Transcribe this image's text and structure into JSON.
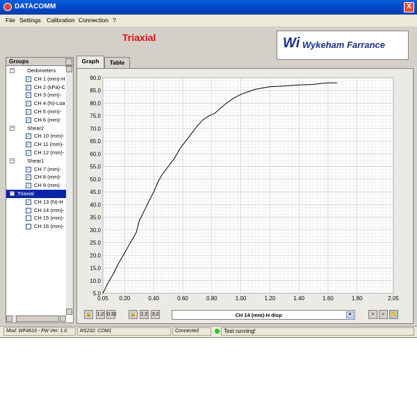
{
  "window": {
    "title": "DATACOMM",
    "close_label": "X"
  },
  "menu": [
    "File",
    "Settings",
    "Calibration",
    "Connection",
    "?"
  ],
  "app_title": "Triaxial",
  "logo": {
    "mark": "Wi",
    "text": "Wykeham Farrance"
  },
  "groups_panel": {
    "header": "Groups",
    "rows": [
      {
        "type": "group",
        "label": "Oedometers",
        "expander": "−",
        "selected": false
      },
      {
        "type": "channel",
        "label": "CH 1 (mm)-H",
        "checked": true
      },
      {
        "type": "channel",
        "label": "CH 2 (kPa)-C",
        "checked": true
      },
      {
        "type": "channel",
        "label": "CH 3 (mm)-",
        "checked": true
      },
      {
        "type": "channel",
        "label": "CH 4 (N)-Loa",
        "checked": true
      },
      {
        "type": "channel",
        "label": "CH 5 (mm)-",
        "checked": true
      },
      {
        "type": "channel",
        "label": "CH 6 (mm)-",
        "checked": true
      },
      {
        "type": "group",
        "label": "Shear2",
        "expander": "−",
        "selected": false
      },
      {
        "type": "channel",
        "label": "CH 10 (mm)-",
        "checked": true
      },
      {
        "type": "channel",
        "label": "CH 11 (mm)-",
        "checked": true
      },
      {
        "type": "channel",
        "label": "CH 12 (mm)-",
        "checked": true
      },
      {
        "type": "group",
        "label": "Shear1",
        "expander": "−",
        "selected": false
      },
      {
        "type": "channel",
        "label": "CH 7 (mm)-",
        "checked": true
      },
      {
        "type": "channel",
        "label": "CH 8 (mm)-",
        "checked": true
      },
      {
        "type": "channel",
        "label": "CH 9 (mm)-",
        "checked": true
      },
      {
        "type": "group",
        "label": "Triaxial",
        "expander": "−",
        "selected": true
      },
      {
        "type": "channel",
        "label": "CH 13 (N)-H",
        "checked": true
      },
      {
        "type": "channel",
        "label": "CH 14 (mm)-",
        "checked": false
      },
      {
        "type": "channel",
        "label": "CH 15 (mm)-",
        "checked": false
      },
      {
        "type": "channel",
        "label": "CH 16 (mm)-",
        "checked": false
      }
    ]
  },
  "tabs": [
    {
      "label": "Graph",
      "active": true
    },
    {
      "label": "Table",
      "active": false
    }
  ],
  "toolbar": {
    "left_buttons": [
      "lock-icon",
      "x-scale-icon",
      "x-format-icon"
    ],
    "left_labels": [
      "🔒",
      "1.2",
      "0.32"
    ],
    "right_buttons": [
      "lock-icon",
      "y-scale-icon",
      "y-format-icon"
    ],
    "right_labels": [
      "🔒",
      "1.2",
      "3.2"
    ],
    "tools": [
      "crosshair-icon",
      "zoom-icon",
      "hand-icon"
    ],
    "tool_labels": [
      "+",
      "⌕",
      "✋"
    ]
  },
  "channel_select": {
    "value": "CH 14 (mm)-H disp"
  },
  "status": {
    "version": "Mod: WF4616 - FW Ver: 1.0",
    "port": "RS232: COM1",
    "connection": "Connected",
    "message": "Test running!",
    "led_color": "#22c422"
  },
  "chart_data": {
    "type": "line",
    "title": "",
    "xlabel": "",
    "ylabel": "",
    "xlim": [
      0.05,
      2.05
    ],
    "ylim": [
      5.0,
      90.0
    ],
    "x_ticks": [
      "0.05",
      "0.20",
      "0.40",
      "0.60",
      "0.80",
      "1.00",
      "1.20",
      "1.40",
      "1.60",
      "1.80",
      "2.05"
    ],
    "x_tick_values": [
      0.05,
      0.2,
      0.4,
      0.6,
      0.8,
      1.0,
      1.2,
      1.4,
      1.6,
      1.8,
      2.05
    ],
    "y_ticks": [
      "5.0",
      "10.0",
      "15.0",
      "20.0",
      "25.0",
      "30.0",
      "35.0",
      "40.0",
      "45.0",
      "50.0",
      "55.0",
      "60.0",
      "65.0",
      "70.0",
      "75.0",
      "80.0",
      "85.0",
      "90.0"
    ],
    "y_tick_values": [
      5,
      10,
      15,
      20,
      25,
      30,
      35,
      40,
      45,
      50,
      55,
      60,
      65,
      70,
      75,
      80,
      85,
      90
    ],
    "grid": true,
    "series": [
      {
        "color": "#000000",
        "x": [
          0.05,
          0.08,
          0.1,
          0.13,
          0.15,
          0.18,
          0.2,
          0.24,
          0.28,
          0.3,
          0.33,
          0.36,
          0.4,
          0.43,
          0.46,
          0.5,
          0.54,
          0.58,
          0.62,
          0.66,
          0.7,
          0.74,
          0.78,
          0.82,
          0.86,
          0.9,
          0.95,
          1.0,
          1.05,
          1.1,
          1.15,
          1.2,
          1.3,
          1.4,
          1.5,
          1.55,
          1.6,
          1.66
        ],
        "y": [
          5.0,
          8.5,
          10.5,
          13.5,
          16.0,
          19.0,
          21.0,
          25.0,
          29.0,
          33.5,
          37.0,
          40.5,
          45.0,
          49.0,
          52.0,
          55.0,
          58.0,
          62.0,
          65.0,
          68.0,
          71.0,
          73.5,
          75.0,
          76.0,
          78.0,
          80.0,
          82.0,
          83.5,
          84.5,
          85.5,
          86.0,
          86.5,
          86.8,
          87.2,
          87.4,
          87.8,
          88.0,
          88.0
        ]
      }
    ]
  }
}
